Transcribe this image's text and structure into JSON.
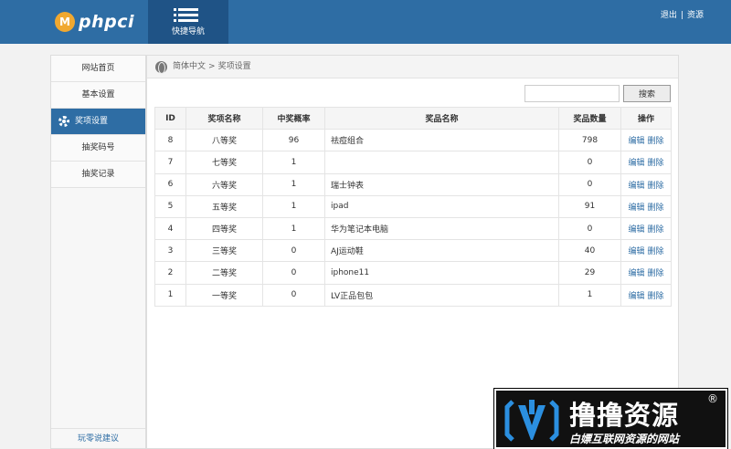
{
  "header": {
    "logo_badge": "M",
    "logo_text": "phpci",
    "quick_nav_label": "快捷导航",
    "logout_label": "退出",
    "separator": "|",
    "home_label": "资源"
  },
  "sidebar": {
    "items": [
      {
        "label": "网站首页",
        "active": false
      },
      {
        "label": "基本设置",
        "active": false
      },
      {
        "label": "奖项设置",
        "active": true
      },
      {
        "label": "抽奖码号",
        "active": false
      },
      {
        "label": "抽奖记录",
        "active": false
      }
    ],
    "footer_label": "玩零说建议"
  },
  "breadcrumb": {
    "root": "简体中文",
    "separator": ">",
    "current": "奖项设置"
  },
  "search": {
    "placeholder": "",
    "value": "",
    "button_label": "搜索"
  },
  "table": {
    "columns": [
      "ID",
      "奖项名称",
      "中奖概率",
      "奖品名称",
      "奖品数量",
      "操作"
    ],
    "rows": [
      {
        "id": "8",
        "level": "八等奖",
        "prob": "96",
        "goods": "祛痘组合",
        "qty": "798"
      },
      {
        "id": "7",
        "level": "七等奖",
        "prob": "1",
        "goods": "",
        "qty": "0"
      },
      {
        "id": "6",
        "level": "六等奖",
        "prob": "1",
        "goods": "瑞士钟表",
        "qty": "0"
      },
      {
        "id": "5",
        "level": "五等奖",
        "prob": "1",
        "goods": "ipad",
        "qty": "91"
      },
      {
        "id": "4",
        "level": "四等奖",
        "prob": "1",
        "goods": "华为笔记本电脑",
        "qty": "0"
      },
      {
        "id": "3",
        "level": "三等奖",
        "prob": "0",
        "goods": "AJ运动鞋",
        "qty": "40"
      },
      {
        "id": "2",
        "level": "二等奖",
        "prob": "0",
        "goods": "iphone11",
        "qty": "29"
      },
      {
        "id": "1",
        "level": "一等奖",
        "prob": "0",
        "goods": "LV正品包包",
        "qty": "1"
      }
    ],
    "edit_label": "编辑",
    "delete_label": "删除"
  },
  "watermark": {
    "title": "撸撸资源",
    "reg_mark": "®",
    "subtitle": "白嫖互联网资源的网站"
  },
  "colors": {
    "brand_blue": "#2e6da4",
    "nav_dark": "#1f5386",
    "logo_orange": "#f0a830"
  }
}
